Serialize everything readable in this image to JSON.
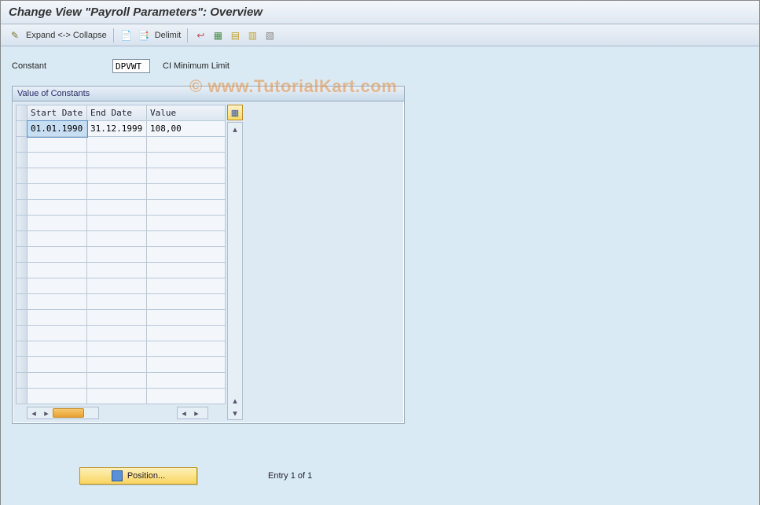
{
  "title": "Change View \"Payroll Parameters\": Overview",
  "watermark": "© www.TutorialKart.com",
  "toolbar": {
    "expand_collapse": "Expand <-> Collapse",
    "delimit": "Delimit"
  },
  "constant": {
    "label": "Constant",
    "value": "DPVWT",
    "description": "CI Minimum Limit"
  },
  "grid": {
    "title": "Value of Constants",
    "columns": {
      "start": "Start Date",
      "end": "End Date",
      "value": "Value"
    },
    "rows": [
      {
        "start": "01.01.1990",
        "end": "31.12.1999",
        "value": "108,00"
      }
    ],
    "blank_rows": 17
  },
  "footer": {
    "position_label": "Position...",
    "entry_text": "Entry 1 of 1"
  }
}
